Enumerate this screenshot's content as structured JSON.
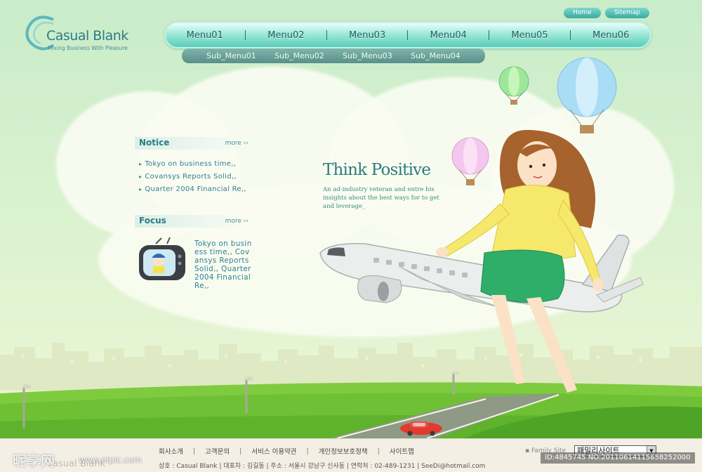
{
  "brand": {
    "title": "Casual Blank",
    "tagline": "Mixing Business With Pleasure"
  },
  "top_links": {
    "home": "Home",
    "sitemap": "Sitemap"
  },
  "menu": [
    "Menu01",
    "Menu02",
    "Menu03",
    "Menu04",
    "Menu05",
    "Menu06"
  ],
  "submenu": [
    "Sub_Menu01",
    "Sub_Menu02",
    "Sub_Menu03",
    "Sub_Menu04"
  ],
  "notice": {
    "title": "Notice",
    "more": "more ››",
    "items": [
      "Tokyo on business time,,",
      "Covansys Reports Solid,,",
      "Quarter 2004 Financial Re,,"
    ]
  },
  "focus": {
    "title": "Focus",
    "more": "more ››",
    "text": "Tokyo on business time,, Covansys Reports Solid,, Quarter 2004 Financial Re,,"
  },
  "hero": {
    "title": "Think Positive",
    "description": "An ad-industry veteran and entre his insights about the best ways for to get and leverage_"
  },
  "footer": {
    "links": [
      "회사소개",
      "고객문의",
      "서비스 이용약관",
      "개인정보보호정책",
      "사이트맵"
    ],
    "info": "상호 : Casual Blank  |  대표자 : 김길동  |  주소 : 서울시 강남구 신사동  |  연락처 : 02-489-1231  |  SeeDi@hotmail.com",
    "family_label": "▪ Family Site",
    "family_value": "패밀리사이트",
    "logo": "Casual Blank"
  },
  "watermark": {
    "brand": "昵享网",
    "url": "www.nipic.com",
    "image_id": "ID:4845745 NO:20110614115658252000"
  },
  "colors": {
    "accent": "#2a7d79",
    "menu": "#57cdb9",
    "link": "#2e7e95"
  }
}
